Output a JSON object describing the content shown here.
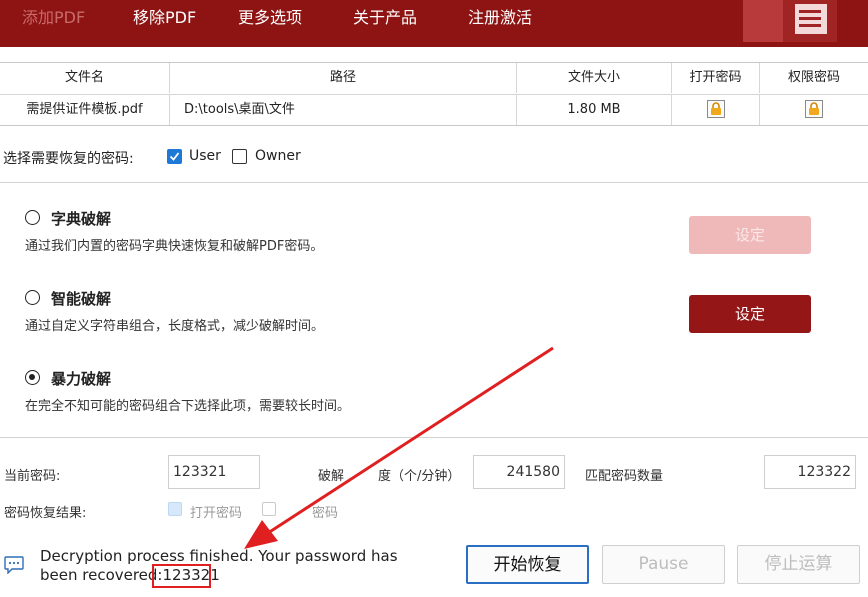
{
  "toolbar": {
    "add_pdf": "添加PDF",
    "remove_pdf": "移除PDF",
    "more_options": "更多选项",
    "about": "关于产品",
    "register": "注册激活"
  },
  "table": {
    "headers": [
      "文件名",
      "路径",
      "文件大小",
      "打开密码",
      "权限密码"
    ],
    "rows": [
      {
        "name": "需提供证件模板.pdf",
        "path": "D:\\tools\\桌面\\文件",
        "size": "1.80 MB"
      }
    ]
  },
  "password_select": {
    "label": "选择需要恢复的密码:",
    "user": {
      "label": "User",
      "checked": true
    },
    "owner": {
      "label": "Owner",
      "checked": false
    }
  },
  "methods": {
    "dictionary": {
      "title": "字典破解",
      "desc": "通过我们内置的密码字典快速恢复和破解PDF密码。",
      "selected": false,
      "set_label": "设定"
    },
    "smart": {
      "title": "智能破解",
      "desc": "通过自定义字符串组合，长度格式，减少破解时间。",
      "selected": false,
      "set_label": "设定"
    },
    "brute": {
      "title": "暴力破解",
      "desc": "在完全不知可能的密码组合下选择此项，需要较长时间。",
      "selected": true
    }
  },
  "stats": {
    "current_label": "当前密码:",
    "current_value": "123321",
    "speed_label_a": "破解",
    "speed_label_b": "度（个/分钟）",
    "speed_value": "241580",
    "match_label": "匹配密码数量",
    "match_value": "123322",
    "result_label": "密码恢复结果:",
    "result_open": "打开密码",
    "result_perm": "密码"
  },
  "status": {
    "line1": "Decryption process finished. Your password has",
    "line2_prefix": "been recovered:",
    "password": "123321"
  },
  "buttons": {
    "start": "开始恢复",
    "pause": "Pause",
    "stop": "停止运算"
  },
  "colors": {
    "brand": "#8e1414",
    "accent_blue": "#1e78d6",
    "highlight_red": "#e02020"
  }
}
